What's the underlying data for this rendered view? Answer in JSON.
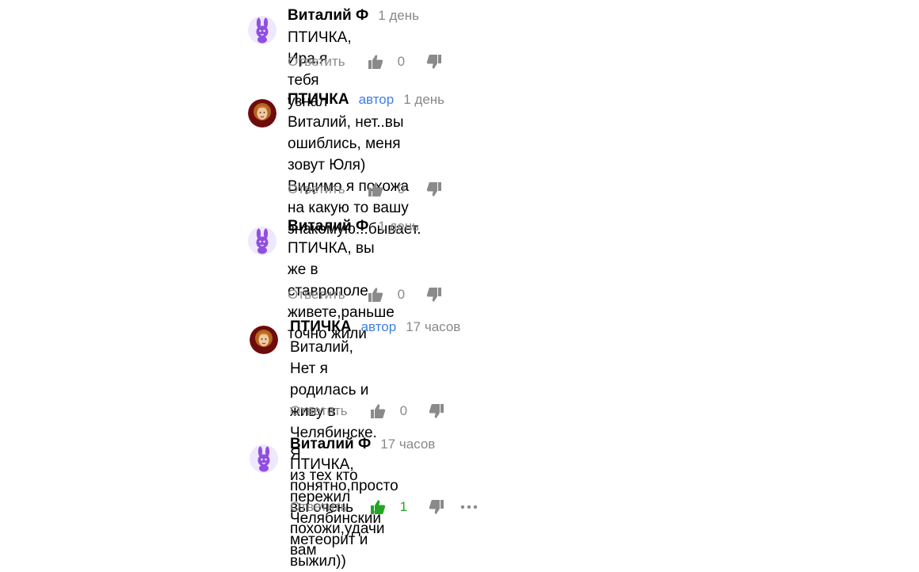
{
  "comments": [
    {
      "author": "Виталий Ф",
      "badge": "",
      "time": "1 день",
      "avatar": "bunny",
      "text": "ПТИЧКА, Ира,я тебя узнал",
      "reply": "Ответить",
      "likes": "0",
      "liked": false
    },
    {
      "author": "ПТИЧКА",
      "badge": "автор",
      "time": "1 день",
      "avatar": "photo",
      "text": "Виталий, нет..вы ошиблись, меня зовут Юля)\nВидимо я похожа на какую то вашу\nзнакомую...бывает.",
      "reply": "Ответить",
      "likes": "0",
      "liked": false
    },
    {
      "author": "Виталий Ф",
      "badge": "",
      "time": "1 день",
      "avatar": "bunny",
      "text": "ПТИЧКА, вы же в ставрополе живете,раньше\nточно жили",
      "reply": "Ответить",
      "likes": "0",
      "liked": false
    },
    {
      "author": "ПТИЧКА",
      "badge": "автор",
      "time": "17 часов",
      "avatar": "photo",
      "text": "Виталий, Нет я родилась и живу в Челябинске. Я\nиз тех кто пережил Челябинский метеорит и\nвыжил))",
      "reply": "Ответить",
      "likes": "0",
      "liked": false
    },
    {
      "author": "Виталий Ф",
      "badge": "",
      "time": "17 часов",
      "avatar": "bunny",
      "text": "ПТИЧКА, понятно,просто вы очень похожи,удачи\nвам",
      "reply": "Ответить",
      "likes": "1",
      "liked": true
    }
  ],
  "colors": {
    "accent": "#3d7ee6",
    "liked": "#1fa624",
    "muted": "#8a8a8a",
    "bunny": "#8f4fe0"
  },
  "icons": {
    "like": "thumbs-up-icon",
    "dislike": "thumbs-down-icon",
    "more": "more-dots-icon",
    "bunny_avatar": "bunny-icon"
  }
}
